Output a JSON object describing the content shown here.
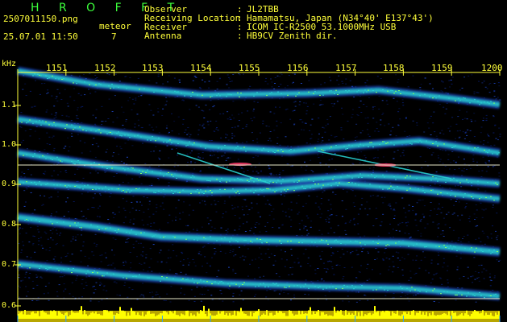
{
  "header": {
    "brand": "H R O F F T",
    "filename": "2507011150.png",
    "datetime": "25.07.01 11:50",
    "meteor_label": "meteor",
    "meteor_count": "7",
    "info": [
      {
        "key": "Observer",
        "value": "JL2TBB"
      },
      {
        "key": "Receiving Location",
        "value": "Hamamatsu, Japan (N34°40' E137°43')"
      },
      {
        "key": "Receiver",
        "value": "ICOM IC-R2500 53.1000MHz USB"
      },
      {
        "key": "Antenna",
        "value": "HB9CV Zenith dir."
      }
    ]
  },
  "spectrogram": {
    "unit_label": "kHz",
    "time_ticks": [
      "1151",
      "1152",
      "1153",
      "1154",
      "1155",
      "1156",
      "1157",
      "1158",
      "1159",
      "1200"
    ],
    "freq_ticks": [
      "1.1",
      "1.0",
      "0.9",
      "0.8",
      "0.7",
      "0.6"
    ],
    "colors": {
      "background": "#000000",
      "noise_dark": "#071a66",
      "noise_light": "#1e47c8",
      "band": "#28d0d0",
      "band_hot": "#7cff6a",
      "text": "#ffff3a",
      "grid": "#ffff3a",
      "reference_line": "#e8e8c8",
      "echo_hot": "#ff3a6a",
      "level_bar": "#ffff00"
    }
  }
}
